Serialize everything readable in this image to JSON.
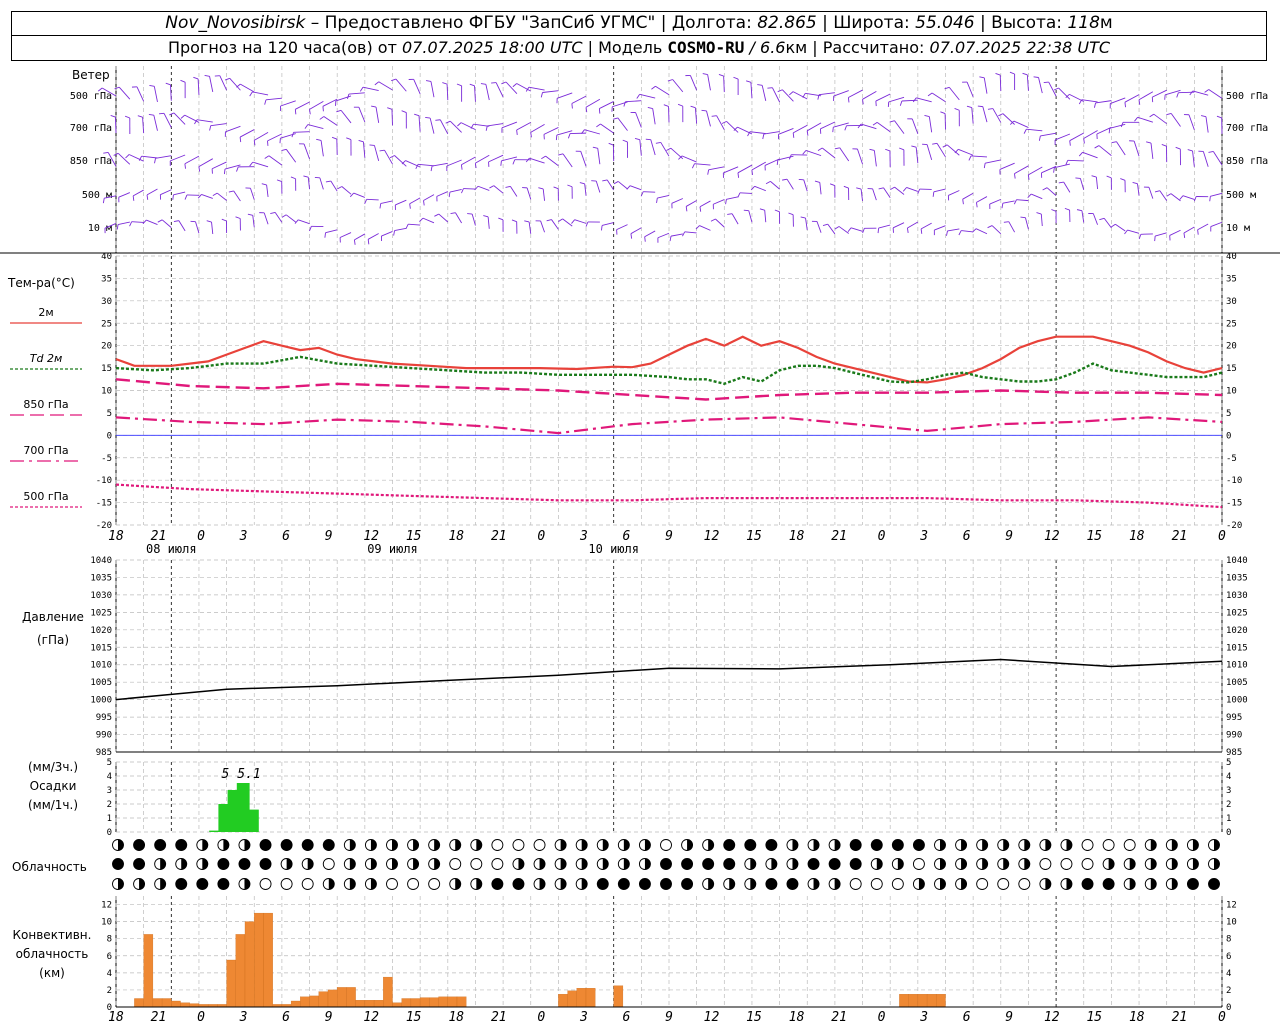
{
  "header": {
    "station": "Nov_Novosibirsk",
    "provider": "– Предоставлено ФГБУ \"ЗапСиб УГМС\" |",
    "lon_label": "Долгота:",
    "lon": "82.865",
    "lat_label": "| Широта:",
    "lat": "55.046",
    "alt_label": "| Высота:",
    "alt": "118",
    "alt_unit": "м",
    "forecast_prefix": "Прогноз на 120 часа(ов) от",
    "issue_time": "07.07.2025 18:00 UTC",
    "model_prefix": "| Модель",
    "model": "COSMO-RU",
    "resolution": "/ 6.6",
    "resolution_unit": "км",
    "computed_label": "| Рассчитано:",
    "computed_time": "07.07.2025 22:38 UTC"
  },
  "panels": {
    "wind": {
      "title": "Ветер",
      "levels": [
        "500 гПа",
        "700 гПа",
        "850 гПа",
        "500 м",
        "10 м"
      ]
    },
    "temperature": {
      "title": "Тем-ра(°C)",
      "legend": [
        {
          "label": "2м",
          "color": "#e8423a",
          "style": "solid"
        },
        {
          "label": "Td 2м",
          "color": "#1a7a1a",
          "style": "dotted"
        },
        {
          "label": "850 гПа",
          "color": "#e0187a",
          "style": "dash"
        },
        {
          "label": "700 гПа",
          "color": "#e0187a",
          "style": "dashdot"
        },
        {
          "label": "500 гПа",
          "color": "#e0187a",
          "style": "fine-dot"
        }
      ],
      "yticks": [
        "40",
        "35",
        "30",
        "25",
        "20",
        "15",
        "10",
        "5",
        "0",
        "-5",
        "-10",
        "-15",
        "-20"
      ]
    },
    "pressure": {
      "title": "Давление",
      "unit": "(гПа)",
      "yticks": [
        "1040",
        "1035",
        "1030",
        "1025",
        "1020",
        "1015",
        "1010",
        "1005",
        "1000",
        "995",
        "990",
        "985"
      ]
    },
    "precip": {
      "title_top": "(мм/3ч.)",
      "title": "Осадки",
      "title_bottom": "(мм/1ч.)",
      "yticks": [
        "5",
        "4",
        "3",
        "2",
        "1",
        "0"
      ],
      "annotations": [
        "5",
        "5.1"
      ]
    },
    "clouds": {
      "title": "Облачность"
    },
    "convective": {
      "title_1": "Конвективн.",
      "title_2": "облачность",
      "title_3": "(км)",
      "yticks": [
        "12",
        "10",
        "8",
        "6",
        "4",
        "2",
        "0"
      ]
    }
  },
  "x_axis": {
    "hour_ticks": [
      "18",
      "21",
      "0",
      "3",
      "6",
      "9",
      "12",
      "15",
      "18",
      "21",
      "0",
      "3",
      "6",
      "9",
      "12",
      "15",
      "18",
      "21",
      "0",
      "3",
      "6",
      "9",
      "12",
      "15",
      "18",
      "21",
      "0"
    ],
    "dates": [
      "08 июля",
      "09 июля",
      "10 июля"
    ]
  },
  "colors": {
    "t2m": "#e8423a",
    "td": "#1a7a1a",
    "upper": "#e0187a",
    "zero_line": "#3030ff",
    "wind": "#7a2ad8",
    "precip": "#22cc22",
    "convective": "#ee8833"
  },
  "chart_data": [
    {
      "type": "line",
      "title": "Тем-ра(°C)",
      "x_unit": "hours since 07.07.2025 18:00 UTC",
      "ylim": [
        -20,
        40
      ],
      "series": [
        {
          "name": "2м",
          "x": [
            0,
            2,
            4,
            6,
            8,
            10,
            12,
            14,
            16,
            18,
            20,
            22,
            24,
            26,
            28,
            30,
            34,
            38,
            42,
            46,
            50,
            54,
            56,
            58,
            60,
            62,
            64,
            66,
            68,
            70,
            72,
            74,
            76,
            78,
            80,
            82,
            84,
            86,
            88,
            90,
            92,
            94,
            96,
            98,
            100,
            102,
            104,
            106,
            108,
            110,
            112,
            114,
            116,
            118,
            120
          ],
          "y": [
            17,
            15.5,
            15.5,
            15.5,
            16,
            16.5,
            18,
            19.5,
            21,
            20,
            19,
            19.5,
            18,
            17,
            16.5,
            16,
            15.5,
            15,
            15,
            15,
            14.8,
            15.3,
            15.2,
            16,
            18,
            20,
            21.5,
            20,
            22,
            20,
            21,
            19.5,
            17.5,
            16,
            15,
            14,
            13,
            12,
            11.8,
            12.5,
            13.5,
            15,
            17,
            19.5,
            21,
            22,
            22,
            22,
            21,
            20,
            18.5,
            16.5,
            15,
            14,
            15
          ]
        },
        {
          "name": "Td 2м",
          "x": [
            0,
            4,
            8,
            12,
            16,
            20,
            24,
            28,
            32,
            36,
            40,
            44,
            48,
            52,
            56,
            60,
            62,
            64,
            66,
            68,
            70,
            72,
            74,
            76,
            78,
            80,
            82,
            84,
            86,
            88,
            90,
            92,
            94,
            96,
            98,
            100,
            102,
            104,
            106,
            108,
            110,
            112,
            114,
            116,
            118,
            120
          ],
          "y": [
            15,
            14.5,
            15,
            16,
            16,
            17.5,
            16,
            15.5,
            15,
            14.5,
            14,
            14,
            13.5,
            13.5,
            13.5,
            13,
            12.5,
            12.5,
            11.5,
            13,
            12,
            14.5,
            15.5,
            15.5,
            15,
            14,
            13,
            12,
            11.8,
            12.5,
            13.5,
            14,
            13,
            12.5,
            12,
            12,
            12.5,
            14,
            16,
            14.5,
            14,
            13.5,
            13,
            13,
            13,
            14
          ]
        },
        {
          "name": "850 гПа",
          "x": [
            0,
            8,
            16,
            24,
            32,
            40,
            48,
            56,
            64,
            72,
            80,
            88,
            96,
            104,
            112,
            120
          ],
          "y": [
            12.5,
            11,
            10.5,
            11.5,
            11,
            10.5,
            10,
            9,
            8,
            9,
            9.5,
            9.5,
            10,
            9.5,
            9.5,
            9
          ]
        },
        {
          "name": "700 гПа",
          "x": [
            0,
            8,
            16,
            24,
            32,
            40,
            48,
            56,
            64,
            72,
            80,
            88,
            96,
            104,
            112,
            120
          ],
          "y": [
            4,
            3,
            2.5,
            3.5,
            3,
            2,
            0.5,
            2.5,
            3.5,
            4,
            2.5,
            1,
            2.5,
            3,
            4,
            3
          ]
        },
        {
          "name": "500 гПа",
          "x": [
            0,
            8,
            16,
            24,
            32,
            40,
            48,
            56,
            64,
            72,
            80,
            88,
            96,
            104,
            112,
            120
          ],
          "y": [
            -11,
            -12,
            -12.5,
            -13,
            -13.5,
            -14,
            -14.5,
            -14.5,
            -14,
            -14,
            -14,
            -14,
            -14.5,
            -14.5,
            -15,
            -16
          ]
        }
      ]
    },
    {
      "type": "line",
      "title": "Давление",
      "x_unit": "hours since 07.07.2025 18:00 UTC",
      "ylim": [
        985,
        1040
      ],
      "series": [
        {
          "name": "Давление",
          "x": [
            0,
            6,
            12,
            24,
            36,
            48,
            60,
            72,
            84,
            96,
            108,
            120
          ],
          "y": [
            1000,
            1001.5,
            1003,
            1004,
            1005.5,
            1007,
            1009,
            1008.8,
            1010,
            1011.5,
            1009.5,
            1011
          ]
        }
      ]
    },
    {
      "type": "bar",
      "title": "Осадки",
      "x_unit": "hours since 07.07.2025 18:00 UTC",
      "ylim": [
        0,
        5
      ],
      "x": [
        10,
        11,
        12,
        13,
        14
      ],
      "values": [
        0.1,
        2.0,
        3.0,
        3.5,
        1.6
      ]
    },
    {
      "type": "bar",
      "title": "Конвективн. облачность",
      "x_unit": "hours since 07.07.2025 18:00 UTC",
      "ylim": [
        0,
        13
      ],
      "x": [
        2,
        3,
        4,
        5,
        6,
        7,
        8,
        9,
        10,
        11,
        12,
        13,
        14,
        15,
        16,
        17,
        18,
        19,
        20,
        21,
        22,
        23,
        24,
        25,
        26,
        27,
        28,
        29,
        30,
        31,
        32,
        33,
        34,
        35,
        36,
        37,
        38,
        39,
        40,
        41,
        42,
        43,
        44,
        45,
        46,
        47,
        48,
        49,
        50,
        51,
        52,
        53,
        54,
        55,
        56,
        57,
        58,
        59,
        60,
        61,
        62,
        63,
        64,
        65,
        66,
        67,
        68,
        69,
        70,
        71,
        72,
        73,
        74,
        75,
        76,
        77,
        78,
        79,
        80,
        81,
        82,
        83,
        84,
        85,
        86,
        87,
        88,
        89,
        90,
        91,
        92,
        93,
        94,
        95,
        96,
        97,
        98,
        99,
        100,
        101,
        102,
        103,
        104,
        105,
        106,
        107,
        108,
        109,
        110,
        111,
        112,
        113,
        114,
        115,
        116,
        117,
        118,
        119
      ],
      "values": [
        1,
        8.5,
        1,
        1,
        0.7,
        0.5,
        0.4,
        0.3,
        0.3,
        0.3,
        5.5,
        8.5,
        10,
        11,
        11,
        0.3,
        0.3,
        0.7,
        1.2,
        1.3,
        1.8,
        2,
        2.3,
        2.3,
        0.8,
        0.8,
        0.8,
        3.5,
        0.5,
        1,
        1,
        1.1,
        1.1,
        1.2,
        1.2,
        1.2,
        0,
        0,
        0,
        0,
        0,
        0,
        0,
        0,
        0,
        0,
        1.5,
        1.9,
        2.2,
        2.2,
        0,
        0,
        2.5,
        0,
        0,
        0,
        0,
        0,
        0,
        0,
        0,
        0,
        0,
        0,
        0,
        0,
        0,
        0,
        0,
        0,
        0,
        0,
        0,
        0,
        0,
        0,
        0,
        0,
        0,
        0,
        0,
        0,
        0,
        1.5,
        1.5,
        1.5,
        1.5,
        1.5,
        0,
        0,
        0,
        0,
        0,
        0,
        0,
        0,
        0,
        0,
        0,
        0,
        0,
        0,
        0,
        0,
        0,
        0,
        0,
        0,
        0,
        0,
        0,
        0,
        0,
        0,
        0,
        0,
        0,
        0
      ]
    }
  ]
}
